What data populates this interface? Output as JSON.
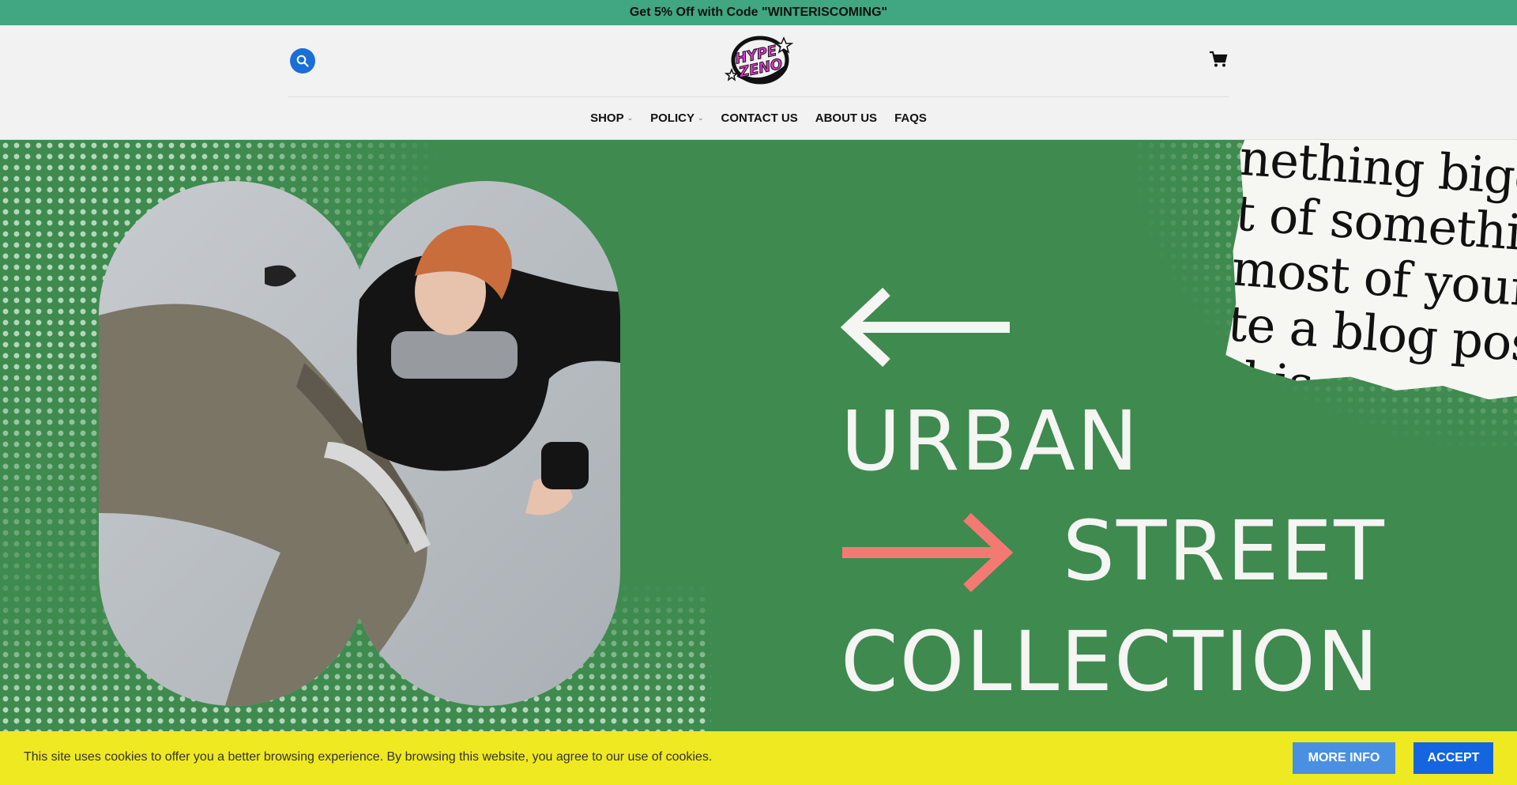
{
  "promo": {
    "text": "Get 5% Off with Code \"WINTERISCOMING\""
  },
  "header": {
    "search_icon": "search-icon",
    "logo_text": "HYPE ZENO",
    "cart_icon": "cart-icon"
  },
  "nav": {
    "items": [
      {
        "label": "SHOP",
        "has_dropdown": true
      },
      {
        "label": "POLICY",
        "has_dropdown": true
      },
      {
        "label": "CONTACT US",
        "has_dropdown": false
      },
      {
        "label": "ABOUT US",
        "has_dropdown": false
      },
      {
        "label": "FAQS",
        "has_dropdown": false
      }
    ]
  },
  "hero": {
    "line1": "URBAN",
    "line2": "STREET",
    "line3": "COLLECTION",
    "paper_lines": [
      "nething bigg",
      "t of somethi",
      "most of your",
      "te a blog post",
      "this"
    ]
  },
  "cookie": {
    "text": "This site uses cookies to offer you a better browsing experience. By browsing this website, you agree to our use of cookies.",
    "more_info": "MORE INFO",
    "accept": "ACCEPT"
  },
  "colors": {
    "promo_bg": "#41a682",
    "hero_bg": "#3e8a4f",
    "cookie_bg": "#efe922",
    "accent_blue": "#1565e0",
    "arrow_red": "#f27a72"
  }
}
